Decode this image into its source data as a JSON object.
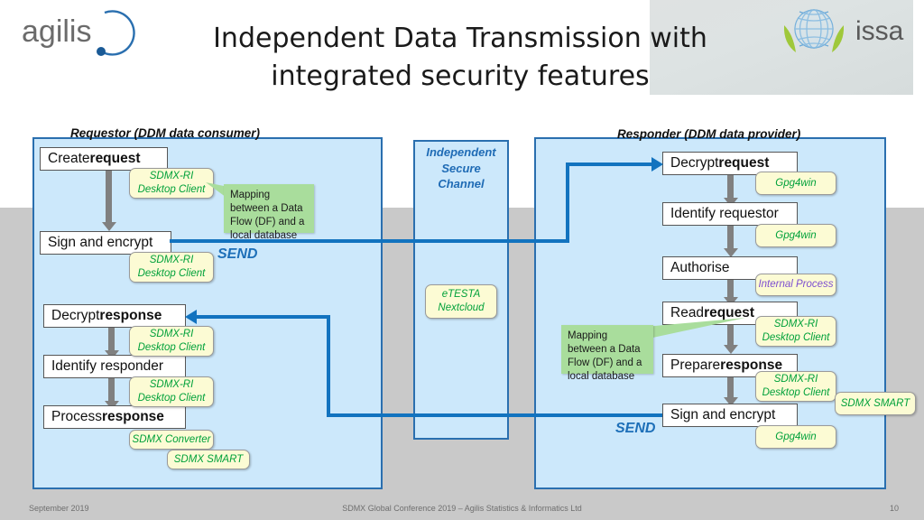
{
  "slide": {
    "title_line1": "Independent Data Transmission with",
    "title_line2": "integrated security features",
    "logo_left": "agilis-logo",
    "logo_right": "issa-logo"
  },
  "requestor": {
    "caption": "Requestor (DDM data consumer)",
    "steps": [
      {
        "text_plain": "Create request",
        "lead": "Create ",
        "strong": "request"
      },
      {
        "text_plain": "Sign and encrypt",
        "lead": "Sign and encrypt",
        "strong": ""
      },
      {
        "text_plain": "Decrypt response",
        "lead": "Decrypt ",
        "strong": "response"
      },
      {
        "text_plain": "Identify responder",
        "lead": "Identify responder",
        "strong": ""
      },
      {
        "text_plain": "Process response",
        "lead": "Process ",
        "strong": "response"
      }
    ],
    "callouts": [
      {
        "line1": "SDMX-RI",
        "line2": "Desktop Client"
      },
      {
        "line1": "SDMX-RI",
        "line2": "Desktop Client"
      },
      {
        "line1": "SDMX-RI",
        "line2": "Desktop Client"
      },
      {
        "line1": "SDMX-RI",
        "line2": "Desktop Client"
      },
      {
        "line1": "SDMX Converter",
        "line2": ""
      },
      {
        "line1": "SDMX SMART",
        "line2": ""
      }
    ],
    "mapping_note": "Mapping between a Data Flow (DF) and a local database",
    "send_label": "SEND"
  },
  "channel": {
    "title_line1": "Independent",
    "title_line2": "Secure",
    "title_line3": "Channel",
    "callout": {
      "line1": "eTESTA",
      "line2": "Nextcloud"
    }
  },
  "responder": {
    "caption": "Responder (DDM data provider)",
    "steps": [
      {
        "text_plain": "Decrypt request",
        "lead": "Decrypt ",
        "strong": "request"
      },
      {
        "text_plain": "Identify requestor",
        "lead": "Identify requestor",
        "strong": ""
      },
      {
        "text_plain": "Authorise",
        "lead": "Authorise",
        "strong": ""
      },
      {
        "text_plain": "Read request",
        "lead": "Read ",
        "strong": "request"
      },
      {
        "text_plain": "Prepare response",
        "lead": "Prepare ",
        "strong": "response"
      },
      {
        "text_plain": "Sign and encrypt",
        "lead": "Sign and encrypt",
        "strong": ""
      }
    ],
    "callouts": [
      {
        "line1": "Gpg4win",
        "line2": ""
      },
      {
        "line1": "Gpg4win",
        "line2": ""
      },
      {
        "line1": "Internal Process",
        "line2": ""
      },
      {
        "line1": "SDMX-RI",
        "line2": "Desktop Client"
      },
      {
        "line1": "SDMX-RI",
        "line2": "Desktop Client"
      },
      {
        "line1": "SDMX SMART",
        "line2": ""
      },
      {
        "line1": "Gpg4win",
        "line2": ""
      }
    ],
    "mapping_note": "Mapping between a Data Flow (DF) and a local database",
    "send_label": "SEND"
  },
  "footer": {
    "date": "September 2019",
    "center": "SDMX Global Conference 2019 – Agilis Statistics & Informatics Ltd",
    "page": "10"
  },
  "colors": {
    "panel_fill": "#cce8fb",
    "panel_border": "#2a6faf",
    "flow_blue": "#1273bf",
    "callout_yellow": "#fcfbd4",
    "callout_green_text": "#00a13a",
    "internal_process_text": "#7d4fd0",
    "mapping_green": "#a9dd9c",
    "gray_band": "#c9c9c9",
    "connector_gray": "#808080"
  }
}
